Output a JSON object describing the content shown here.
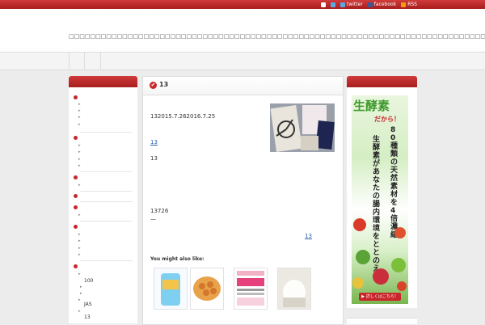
{
  "toplinks": {
    "twitter": "twitter",
    "facebook": "facebook",
    "rss": "RSS"
  },
  "header": {
    "description": "□□□□□□□□□□□□□□□□□□□□□□□□□□□□□□□□□□□□□□□□□□□□□□□□□□□□□□□□□□□□□□□□□□□□□□□□□□□□□□□□□□□□□□□□"
  },
  "sidebar": {
    "labels": [
      "100",
      "JAS",
      "13"
    ]
  },
  "post": {
    "title": "13",
    "date_line": "132015.7.262016.7.25",
    "link1": "13",
    "text1": "13",
    "text2": "13726",
    "dash": "—",
    "link2": "13",
    "related_title": "You might also like:"
  },
  "ad": {
    "big": "生酵素",
    "small": "だから！",
    "line1": "80種類の天然素材を4倍濃縮！",
    "line2": "生酵素があなたの腸内環境をととのえる！",
    "button": "▶ 詳しくはこちら！"
  }
}
